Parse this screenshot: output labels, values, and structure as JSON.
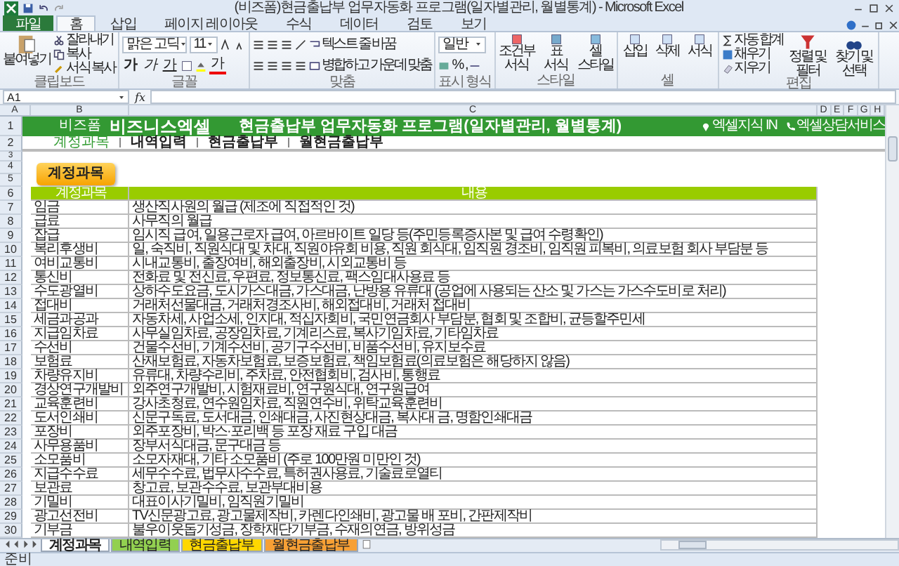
{
  "window": {
    "title": "(비즈폼)현금출납부 업무자동화 프로그램(일자별관리, 월별통계) - Microsoft Excel"
  },
  "ribbon_tabs": [
    {
      "label": "파일",
      "kind": "file",
      "selected": false
    },
    {
      "label": "홈",
      "kind": "tab",
      "selected": true
    },
    {
      "label": "삽입",
      "kind": "tab",
      "selected": false
    },
    {
      "label": "페이지 레이아웃",
      "kind": "tab",
      "selected": false
    },
    {
      "label": "수식",
      "kind": "tab",
      "selected": false
    },
    {
      "label": "데이터",
      "kind": "tab",
      "selected": false
    },
    {
      "label": "검토",
      "kind": "tab",
      "selected": false
    },
    {
      "label": "보기",
      "kind": "tab",
      "selected": false
    }
  ],
  "ribbon": {
    "clipboard": {
      "paste": "붙여넣기",
      "items": [
        "잘라내기",
        "복사",
        "서식 복사"
      ],
      "label": "클립보드"
    },
    "font": {
      "name": "맑은 고딕",
      "size": "11",
      "bold": "가",
      "italic": "가",
      "underline": "가",
      "font_color": "가",
      "label": "글꼴"
    },
    "alignment": {
      "wrap": "텍스트 줄 바꿈",
      "merge": "병합하고 가운데 맞춤",
      "label": "맞춤"
    },
    "number": {
      "format": "일반",
      "percent": "%",
      "comma": ",",
      "label": "표시 형식"
    },
    "styles": {
      "buttons": [
        "조건부 서식",
        "표 서식",
        "셀 스타일"
      ],
      "label": "스타일"
    },
    "cells": {
      "buttons": [
        "삽입",
        "삭제",
        "서식"
      ],
      "label": "셀"
    },
    "editing": {
      "items": [
        "자동 합계",
        "채우기",
        "지우기"
      ],
      "buttons": [
        "정렬 및 필터",
        "찾기 및 선택"
      ],
      "label": "편집"
    }
  },
  "formula_bar": {
    "name_box": "A1",
    "fx": "fx"
  },
  "columns": [
    "A",
    "B",
    "C",
    "D",
    "E",
    "F",
    "G",
    "H"
  ],
  "top_rows": [
    "1",
    "2",
    "3",
    "4",
    "5",
    "6"
  ],
  "banner": {
    "brand_small": "비즈폼",
    "brand": "비즈니스엑셀",
    "title": "현금출납부 업무자동화 프로그램(일자별관리, 월별통계)",
    "links": [
      "엑셀지식 IN",
      "엑셀상담서비스"
    ]
  },
  "nav_tabs": [
    {
      "label": "계정과목",
      "selected": true
    },
    {
      "label": "내역입력",
      "selected": false
    },
    {
      "label": "현금출납부",
      "selected": false
    },
    {
      "label": "월현금출납부",
      "selected": false
    }
  ],
  "section_button": "계정과목",
  "table": {
    "columns": [
      "계정과목",
      "내용"
    ],
    "rows": [
      {
        "row": "7",
        "account": "임금",
        "content": "생산직사원의 월급 (제조에 직접적인 것)"
      },
      {
        "row": "8",
        "account": "급료",
        "content": "사무직의 월급"
      },
      {
        "row": "9",
        "account": "잡급",
        "content": "임시직 급여, 일용근로자 급여, 아르바이트 일당 등(주민등록증사본 및 급여 수령확인)"
      },
      {
        "row": "10",
        "account": "복리후생비",
        "content": "일, 숙직비, 직원식대 및 차대, 직원야유회 비용, 직원 회식대, 임직원 경조비, 임직원 피복비, 의료보험 회사 부담분 등"
      },
      {
        "row": "11",
        "account": "여비교통비",
        "content": "시내교통비, 출장여비, 해외출장비, 시외교통비 등"
      },
      {
        "row": "12",
        "account": "통신비",
        "content": "전화료 및 전신료, 우편료, 정보통신료, 팩스임대사용료 등"
      },
      {
        "row": "13",
        "account": "수도광열비",
        "content": "상하수도요금, 도시가스대금, 가스대금, 난방용 유류대 (공업에 사용되는 산소 및 가스는 가스수도비로 처리)"
      },
      {
        "row": "14",
        "account": "접대비",
        "content": "거래처선물대금, 거래처경조사비, 해외접대비, 거래처 접대비"
      },
      {
        "row": "15",
        "account": "세금과공과",
        "content": "자동차세, 사업소세, 인지대, 적십자회비, 국민연금회사 부담분, 협회 및 조합비, 균등할주민세"
      },
      {
        "row": "16",
        "account": "지급임차료",
        "content": "사무실임차료, 공장임차료, 기계리스료, 복사기임차료, 기타임차료"
      },
      {
        "row": "17",
        "account": "수선비",
        "content": "건물수선비, 기계수선비, 공기구수선비, 비품수선비, 유지보수료"
      },
      {
        "row": "18",
        "account": "보험료",
        "content": "산재보험료, 자동차보험료, 보증보험료, 책임보험료(의료보험은 해당하지 않음)"
      },
      {
        "row": "19",
        "account": "차량유지비",
        "content": "유류대, 차량수리비, 주차료, 안전협회비, 검사비, 통행료"
      },
      {
        "row": "20",
        "account": "경상연구개발비",
        "content": "외주연구개발비, 시험재료비, 연구원식대, 연구원급여"
      },
      {
        "row": "21",
        "account": "교육훈련비",
        "content": "강사초청료, 연수원임차료, 직원연수비, 위탁교육훈련비"
      },
      {
        "row": "22",
        "account": "도서인쇄비",
        "content": "신문구독료, 도서대금, 인쇄대금, 사진현상대금, 복사대 금, 명함인쇄대금"
      },
      {
        "row": "23",
        "account": "포장비",
        "content": "외주포장비, 박스·포리백 등 포장 재료 구입 대금"
      },
      {
        "row": "24",
        "account": "사무용품비",
        "content": "장부서식대금, 문구대금 등"
      },
      {
        "row": "25",
        "account": "소모품비",
        "content": "소모자재대, 기타 소모품비 (주로 100만원 미만인 것)"
      },
      {
        "row": "26",
        "account": "지급수수료",
        "content": "세무수수료, 법무사수수료, 특허권사용료, 기술료로열티"
      },
      {
        "row": "27",
        "account": "보관료",
        "content": "창고료, 보관수수료, 보관부대비용"
      },
      {
        "row": "28",
        "account": "기밀비",
        "content": "대표이사기밀비, 임직원기밀비"
      },
      {
        "row": "29",
        "account": "광고선전비",
        "content": "TV신문광고료, 광고물제작비, 카렌다인쇄비, 광고물 배 포비, 간판제작비"
      },
      {
        "row": "30",
        "account": "기부금",
        "content": "불우이웃돕기성금, 장학재단기부금, 수재의연금, 방위성금"
      }
    ]
  },
  "sheet_tabs": [
    {
      "label": "계정과목",
      "selected": true
    },
    {
      "label": "내역입력",
      "selected": false,
      "color": "#92d050"
    },
    {
      "label": "현금출납부",
      "selected": false,
      "color": "#ffd700"
    },
    {
      "label": "월현금출납부",
      "selected": false,
      "color": "#f7a035"
    }
  ],
  "status": "준비"
}
